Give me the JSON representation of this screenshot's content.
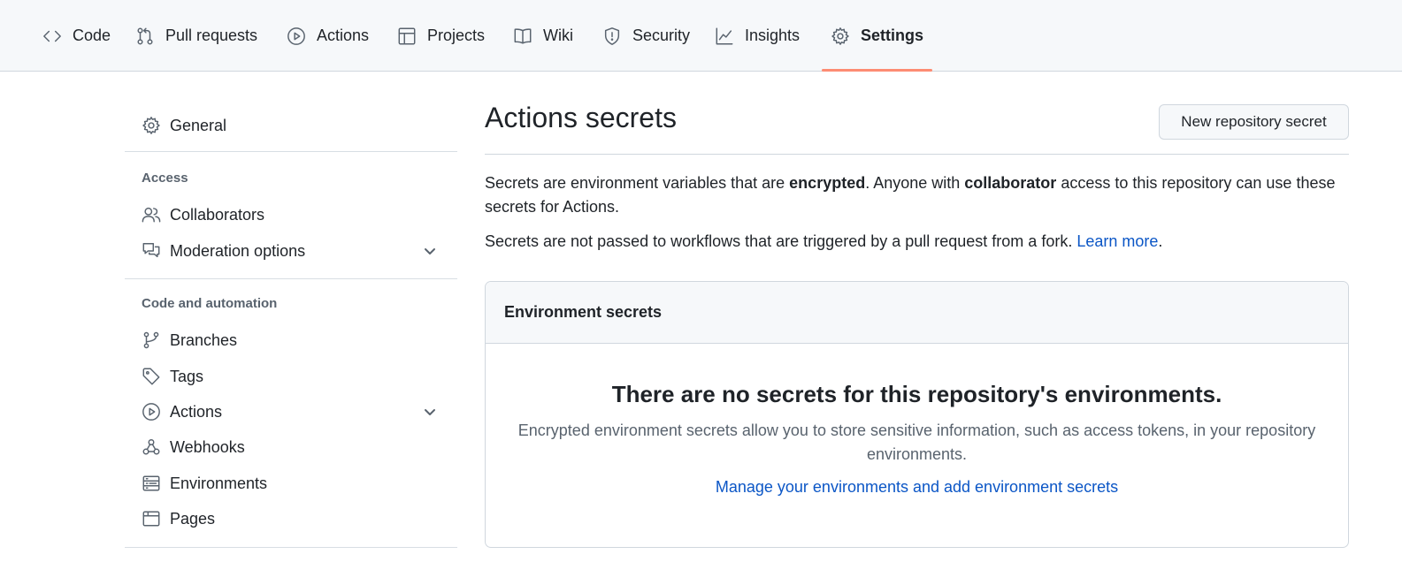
{
  "topnav": {
    "tabs": [
      {
        "label": "Code",
        "icon": "code-icon"
      },
      {
        "label": "Pull requests",
        "icon": "git-pull-request-icon"
      },
      {
        "label": "Actions",
        "icon": "play-icon"
      },
      {
        "label": "Projects",
        "icon": "table-icon"
      },
      {
        "label": "Wiki",
        "icon": "book-icon"
      },
      {
        "label": "Security",
        "icon": "shield-icon"
      },
      {
        "label": "Insights",
        "icon": "graph-icon"
      },
      {
        "label": "Settings",
        "icon": "gear-icon",
        "selected": true
      }
    ],
    "accent": "#fd8c73"
  },
  "sidebar": {
    "general": "General",
    "access_heading": "Access",
    "collaborators": "Collaborators",
    "moderation": "Moderation options",
    "code_heading": "Code and automation",
    "branches": "Branches",
    "tags": "Tags",
    "actions": "Actions",
    "webhooks": "Webhooks",
    "environments": "Environments",
    "pages": "Pages"
  },
  "main": {
    "title": "Actions secrets",
    "new_button": "New repository secret",
    "intro_1": "Secrets are environment variables that are ",
    "intro_bold_1": "encrypted",
    "intro_2": ". Anyone with ",
    "intro_bold_2": "collaborator",
    "intro_3": " access to this repository can use these secrets for Actions.",
    "fork_text": "Secrets are not passed to workflows that are triggered by a pull request from a fork. ",
    "learn_more": "Learn more",
    "fork_end": ".",
    "env_box": {
      "heading": "Environment secrets",
      "blank_title": "There are no secrets for this repository's environments.",
      "blank_desc": "Encrypted environment secrets allow you to store sensitive information, such as access tokens, in your repository environments.",
      "manage_link": "Manage your environments and add environment secrets"
    }
  },
  "colors": {
    "link": "#0b56c6",
    "muted": "#59636e",
    "border": "#d0d7de"
  }
}
